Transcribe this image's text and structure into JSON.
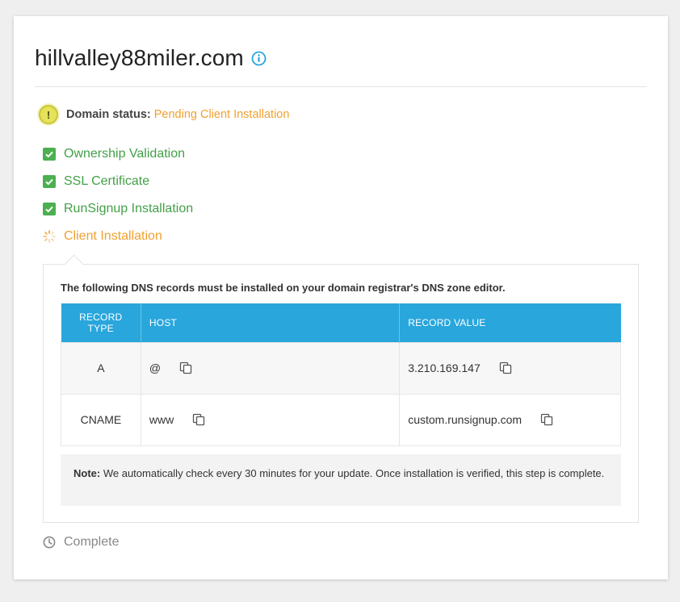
{
  "domain": {
    "name": "hillvalley88miler.com",
    "info_icon": "info-icon"
  },
  "status": {
    "icon": "exclamation-icon",
    "label": "Domain status:",
    "value": "Pending Client Installation"
  },
  "steps": [
    {
      "label": "Ownership Validation",
      "state": "done"
    },
    {
      "label": "SSL Certificate",
      "state": "done"
    },
    {
      "label": "RunSignup Installation",
      "state": "done"
    },
    {
      "label": "Client Installation",
      "state": "pending"
    },
    {
      "label": "Complete",
      "state": "future"
    }
  ],
  "dns": {
    "intro": "The following DNS records must be installed on your domain registrar's DNS zone editor.",
    "columns": {
      "type_line1": "RECORD",
      "type_line2": "TYPE",
      "host": "HOST",
      "value": "RECORD VALUE"
    },
    "rows": [
      {
        "type": "A",
        "host": "@",
        "value": "3.210.169.147"
      },
      {
        "type": "CNAME",
        "host": "www",
        "value": "custom.runsignup.com"
      }
    ]
  },
  "note": {
    "label": "Note:",
    "text": " We automatically check every 30 minutes for your update. Once installation is verified, this step is complete."
  },
  "colors": {
    "accent": "#29a6dc",
    "success": "#43a047",
    "pending": "#f0a030",
    "muted": "#888888"
  }
}
